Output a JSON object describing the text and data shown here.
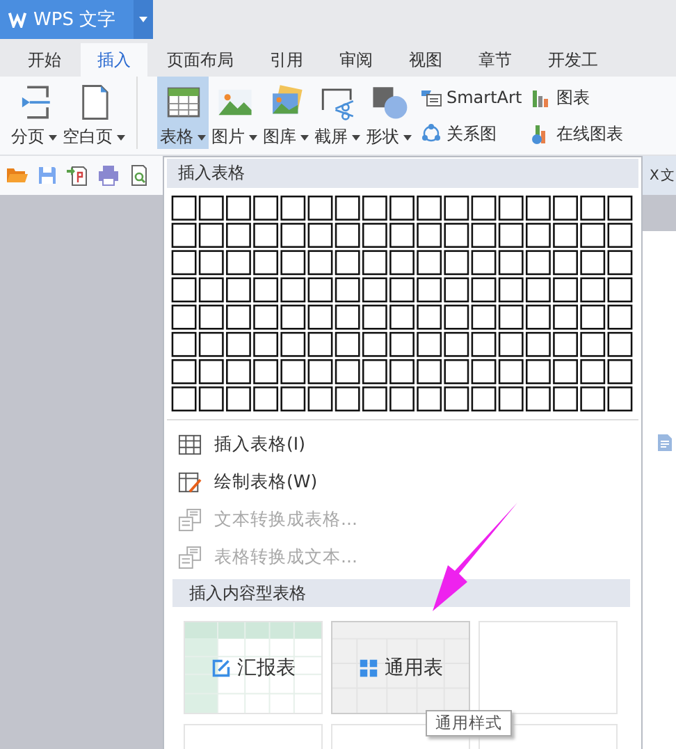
{
  "app": {
    "title": "WPS 文字"
  },
  "tabs": [
    {
      "label": "开始",
      "selected": false
    },
    {
      "label": "插入",
      "selected": true
    },
    {
      "label": "页面布局",
      "selected": false
    },
    {
      "label": "引用",
      "selected": false
    },
    {
      "label": "审阅",
      "selected": false
    },
    {
      "label": "视图",
      "selected": false
    },
    {
      "label": "章节",
      "selected": false
    },
    {
      "label": "开发工",
      "selected": false
    }
  ],
  "ribbon": {
    "large": [
      {
        "label": "分页",
        "kind": "pagebreak",
        "selected": false
      },
      {
        "label": "空白页",
        "kind": "blank",
        "selected": false
      },
      {
        "label": "表格",
        "kind": "table",
        "selected": true
      },
      {
        "label": "图片",
        "kind": "image",
        "selected": false
      },
      {
        "label": "图库",
        "kind": "gallery",
        "selected": false
      },
      {
        "label": "截屏",
        "kind": "screenshot",
        "selected": false
      },
      {
        "label": "形状",
        "kind": "shape",
        "selected": false
      }
    ],
    "small": [
      {
        "label": "SmartArt",
        "kind": "smartart"
      },
      {
        "label": "图表",
        "kind": "chart"
      },
      {
        "label": "关系图",
        "kind": "relation"
      },
      {
        "label": "在线图表",
        "kind": "onlinechart"
      }
    ]
  },
  "document_tab": {
    "label": "X 文"
  },
  "menu": {
    "header": "插入表格",
    "items": [
      {
        "label": "插入表格(I)",
        "kind": "insert",
        "disabled": false
      },
      {
        "label": "绘制表格(W)",
        "kind": "draw",
        "disabled": false
      },
      {
        "label": "文本转换成表格...",
        "kind": "texttotable",
        "disabled": true
      },
      {
        "label": "表格转换成文本...",
        "kind": "tabletotext",
        "disabled": true
      }
    ],
    "section": "插入内容型表格",
    "templates": [
      {
        "label": "汇报表",
        "kind": "report",
        "selected": false
      },
      {
        "label": "通用表",
        "kind": "general",
        "selected": true
      },
      {
        "kind": "blank",
        "selected": false
      }
    ],
    "tooltip": "通用样式"
  }
}
